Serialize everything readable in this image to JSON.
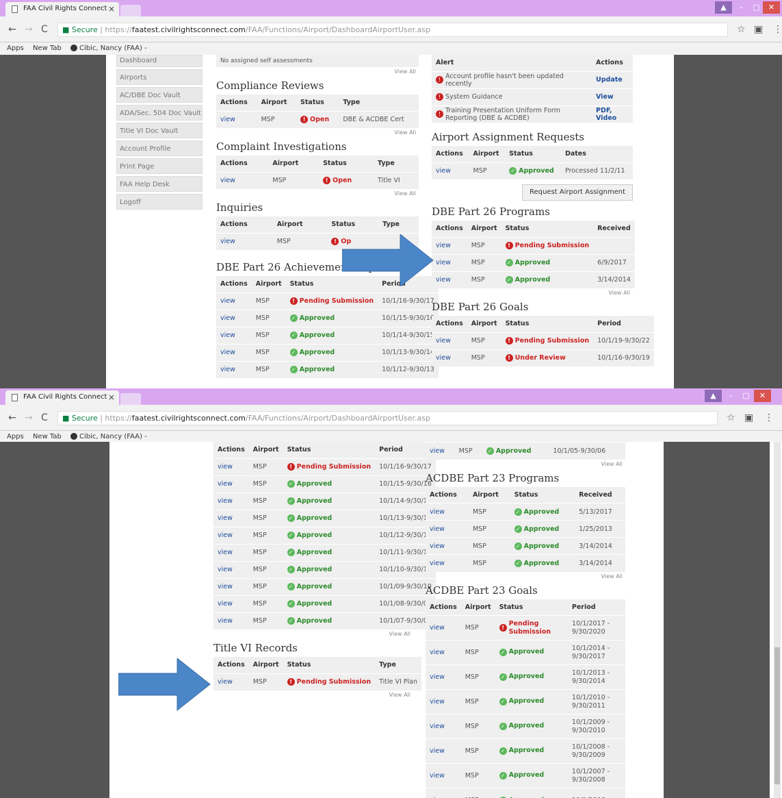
{
  "browser": {
    "tab_title": "FAA Civil Rights Connect",
    "secure_label": "Secure",
    "url_scheme": "https://",
    "url_host": "faatest.civilrightsconnect.com",
    "url_path": "/FAA/Functions/Airport/DashboardAirportUser.asp",
    "bookmarks": [
      "Apps",
      "New Tab",
      "Cibic, Nancy (FAA) -"
    ]
  },
  "sidebar": {
    "items": [
      "Dashboard",
      "Airports",
      "AC/DBE Doc Vault",
      "ADA/Sec. 504 Doc Vault",
      "Title VI Doc Vault",
      "Account Profile",
      "Print Page",
      "FAA Help Desk",
      "Logoff"
    ]
  },
  "shot1": {
    "self_assess_text": "No assigned self assessments",
    "view_all": "View All",
    "compliance": {
      "title": "Compliance Reviews",
      "headers": [
        "Actions",
        "Airport",
        "Status",
        "Type"
      ],
      "rows": [
        {
          "action": "view",
          "airport": "MSP",
          "status": "Open",
          "status_kind": "bad",
          "type": "DBE & ACDBE Cert"
        }
      ]
    },
    "complaint": {
      "title": "Complaint Investigations",
      "headers": [
        "Actions",
        "Airport",
        "Status",
        "Type"
      ],
      "rows": [
        {
          "action": "view",
          "airport": "MSP",
          "status": "Open",
          "status_kind": "bad",
          "type": "Title VI"
        }
      ]
    },
    "inquiries": {
      "title": "Inquiries",
      "headers": [
        "Actions",
        "Airport",
        "Status",
        "Type"
      ],
      "rows": [
        {
          "action": "view",
          "airport": "MSP",
          "status": "Op",
          "status_kind": "bad",
          "type": ""
        }
      ]
    },
    "dbe_ach": {
      "title": "DBE Part 26 Achievement Reports",
      "headers": [
        "Actions",
        "Airport",
        "Status",
        "Period"
      ],
      "rows": [
        {
          "action": "view",
          "airport": "MSP",
          "status": "Pending Submission",
          "status_kind": "bad",
          "period": "10/1/16-9/30/17"
        },
        {
          "action": "view",
          "airport": "MSP",
          "status": "Approved",
          "status_kind": "ok",
          "period": "10/1/15-9/30/16"
        },
        {
          "action": "view",
          "airport": "MSP",
          "status": "Approved",
          "status_kind": "ok",
          "period": "10/1/14-9/30/15"
        },
        {
          "action": "view",
          "airport": "MSP",
          "status": "Approved",
          "status_kind": "ok",
          "period": "10/1/13-9/30/14"
        },
        {
          "action": "view",
          "airport": "MSP",
          "status": "Approved",
          "status_kind": "ok",
          "period": "10/1/12-9/30/13"
        }
      ]
    },
    "alerts": {
      "headers": [
        "Alert",
        "Actions"
      ],
      "rows": [
        {
          "text": "Account profile hasn't been updated recently",
          "action": "Update"
        },
        {
          "text": "System Guidance",
          "action": "View"
        },
        {
          "text": "Training Presentation Uniform Form Reporting (DBE & ACDBE)",
          "action": "PDF, Video"
        }
      ]
    },
    "assign": {
      "title": "Airport Assignment Requests",
      "headers": [
        "Actions",
        "Airport",
        "Status",
        "Dates"
      ],
      "rows": [
        {
          "action": "view",
          "airport": "MSP",
          "status": "Approved",
          "status_kind": "ok",
          "dates": "Processed 11/2/11"
        }
      ],
      "button": "Request Airport Assignment"
    },
    "dbe_prog": {
      "title": "DBE Part 26 Programs",
      "headers": [
        "Actions",
        "Airport",
        "Status",
        "Received"
      ],
      "rows": [
        {
          "action": "view",
          "airport": "MSP",
          "status": "Pending Submission",
          "status_kind": "bad",
          "received": ""
        },
        {
          "action": "view",
          "airport": "MSP",
          "status": "Approved",
          "status_kind": "ok",
          "received": "6/9/2017"
        },
        {
          "action": "view",
          "airport": "MSP",
          "status": "Approved",
          "status_kind": "ok",
          "received": "3/14/2014"
        }
      ]
    },
    "dbe_goals": {
      "title": "DBE Part 26 Goals",
      "headers": [
        "Actions",
        "Airport",
        "Status",
        "Period"
      ],
      "rows": [
        {
          "action": "view",
          "airport": "MSP",
          "status": "Pending Submission",
          "status_kind": "bad",
          "period": "10/1/19-9/30/22"
        },
        {
          "action": "view",
          "airport": "MSP",
          "status": "Under Review",
          "status_kind": "bad",
          "period": "10/1/16-9/30/19"
        }
      ]
    }
  },
  "shot2": {
    "view_all": "View All",
    "dbe_ach": {
      "headers": [
        "Actions",
        "Airport",
        "Status",
        "Period"
      ],
      "rows": [
        {
          "action": "view",
          "airport": "MSP",
          "status": "Pending Submission",
          "status_kind": "bad",
          "period": "10/1/16-9/30/17"
        },
        {
          "action": "view",
          "airport": "MSP",
          "status": "Approved",
          "status_kind": "ok",
          "period": "10/1/15-9/30/16"
        },
        {
          "action": "view",
          "airport": "MSP",
          "status": "Approved",
          "status_kind": "ok",
          "period": "10/1/14-9/30/15"
        },
        {
          "action": "view",
          "airport": "MSP",
          "status": "Approved",
          "status_kind": "ok",
          "period": "10/1/13-9/30/14"
        },
        {
          "action": "view",
          "airport": "MSP",
          "status": "Approved",
          "status_kind": "ok",
          "period": "10/1/12-9/30/13"
        },
        {
          "action": "view",
          "airport": "MSP",
          "status": "Approved",
          "status_kind": "ok",
          "period": "10/1/11-9/30/12"
        },
        {
          "action": "view",
          "airport": "MSP",
          "status": "Approved",
          "status_kind": "ok",
          "period": "10/1/10-9/30/11"
        },
        {
          "action": "view",
          "airport": "MSP",
          "status": "Approved",
          "status_kind": "ok",
          "period": "10/1/09-9/30/10"
        },
        {
          "action": "view",
          "airport": "MSP",
          "status": "Approved",
          "status_kind": "ok",
          "period": "10/1/08-9/30/09"
        },
        {
          "action": "view",
          "airport": "MSP",
          "status": "Approved",
          "status_kind": "ok",
          "period": "10/1/07-9/30/08"
        }
      ]
    },
    "title6": {
      "title": "Title VI Records",
      "headers": [
        "Actions",
        "Airport",
        "Status",
        "Type"
      ],
      "rows": [
        {
          "action": "view",
          "airport": "MSP",
          "status": "Pending Submission",
          "status_kind": "bad",
          "type": "Title VI Plan"
        }
      ]
    },
    "top_row": {
      "action": "view",
      "airport": "MSP",
      "status": "Approved",
      "status_kind": "ok",
      "period": "10/1/05-9/30/06"
    },
    "acdbe_prog": {
      "title": "ACDBE Part 23 Programs",
      "headers": [
        "Actions",
        "Airport",
        "Status",
        "Received"
      ],
      "rows": [
        {
          "action": "view",
          "airport": "MSP",
          "status": "Approved",
          "status_kind": "ok",
          "received": "5/13/2017"
        },
        {
          "action": "view",
          "airport": "MSP",
          "status": "Approved",
          "status_kind": "ok",
          "received": "1/25/2013"
        },
        {
          "action": "view",
          "airport": "MSP",
          "status": "Approved",
          "status_kind": "ok",
          "received": "3/14/2014"
        },
        {
          "action": "view",
          "airport": "MSP",
          "status": "Approved",
          "status_kind": "ok",
          "received": "3/14/2014"
        }
      ]
    },
    "acdbe_goals": {
      "title": "ACDBE Part 23 Goals",
      "headers": [
        "Actions",
        "Airport",
        "Status",
        "Period"
      ],
      "rows": [
        {
          "action": "view",
          "airport": "MSP",
          "status": "Pending Submission",
          "status_kind": "bad",
          "period": "10/1/2017 - 9/30/2020"
        },
        {
          "action": "view",
          "airport": "MSP",
          "status": "Approved",
          "status_kind": "ok",
          "period": "10/1/2014 - 9/30/2017"
        },
        {
          "action": "view",
          "airport": "MSP",
          "status": "Approved",
          "status_kind": "ok",
          "period": "10/1/2013 - 9/30/2014"
        },
        {
          "action": "view",
          "airport": "MSP",
          "status": "Approved",
          "status_kind": "ok",
          "period": "10/1/2010 - 9/30/2011"
        },
        {
          "action": "view",
          "airport": "MSP",
          "status": "Approved",
          "status_kind": "ok",
          "period": "10/1/2009 - 9/30/2010"
        },
        {
          "action": "view",
          "airport": "MSP",
          "status": "Approved",
          "status_kind": "ok",
          "period": "10/1/2008 - 9/30/2009"
        },
        {
          "action": "view",
          "airport": "MSP",
          "status": "Approved",
          "status_kind": "ok",
          "period": "10/1/2007 - 9/30/2008"
        },
        {
          "action": "view",
          "airport": "MSP",
          "status": "Approved",
          "status_kind": "ok",
          "period": "10/1/2006 -"
        }
      ]
    }
  },
  "colors": {
    "accent_arrow": "#4a86c8",
    "ok": "#2e8b2e",
    "bad": "#cc2222",
    "tabbar": "#d9a7f0"
  }
}
